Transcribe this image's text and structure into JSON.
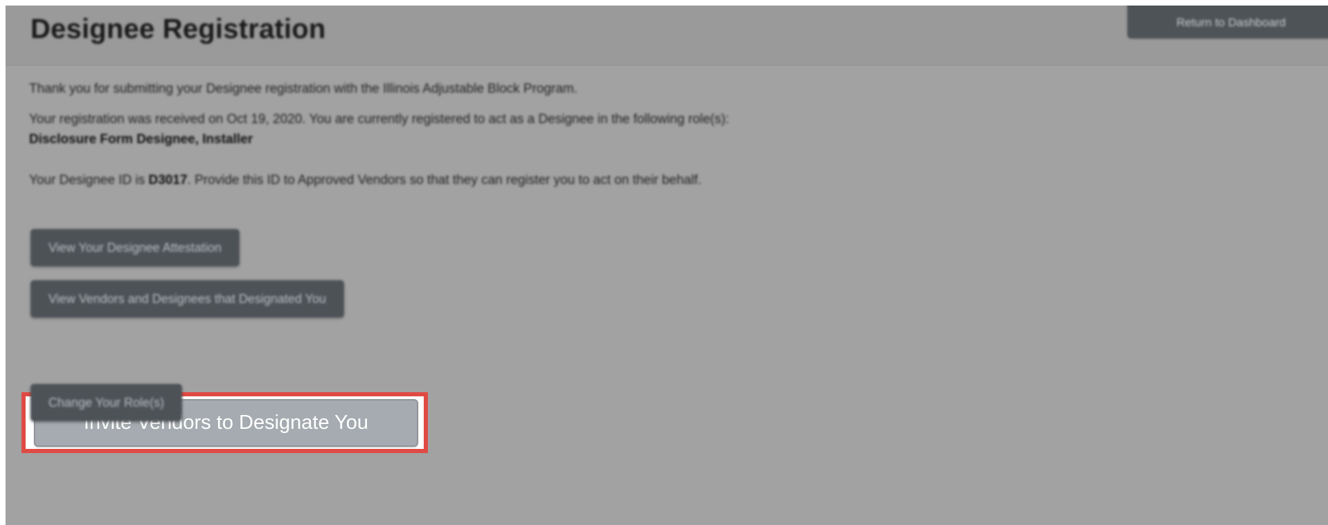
{
  "header": {
    "title": "Designee Registration",
    "return_button_label": "Return to Dashboard"
  },
  "body": {
    "thank_you": "Thank you for submitting your Designee registration with the Illinois Adjustable Block Program.",
    "received": "Your registration was received on Oct 19, 2020. You are currently registered to act as a Designee in the following role(s):",
    "roles": "Disclosure Form Designee, Installer",
    "designee_id_prefix": "Your Designee ID is ",
    "designee_id": "D3017",
    "designee_id_suffix": ". Provide this ID to Approved Vendors so that they can register you to act on their behalf."
  },
  "actions": {
    "view_attestation": "View Your Designee Attestation",
    "view_vendors": "View Vendors and Designees that Designated You",
    "invite_vendors": "Invite Vendors to Designate You",
    "change_roles": "Change Your Role(s)"
  },
  "colors": {
    "highlight": "#e04a44",
    "overlay": "#a2a2a2",
    "button_dark": "#4d5257",
    "button_active": "#a5abb0"
  }
}
